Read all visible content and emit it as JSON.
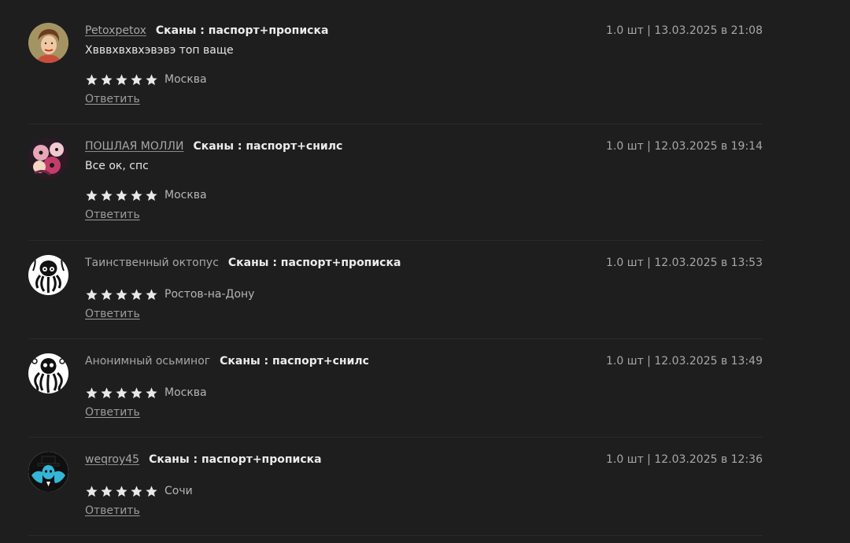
{
  "reviews": [
    {
      "author": "Petoxpetox",
      "product": "Сканы : паспорт+прописка",
      "meta": "1.0 шт | 13.03.2025 в 21:08",
      "text": "Хвввхвхвхэвэвэ топ ваще",
      "rating": 5,
      "city": "Москва",
      "reply": "Ответить",
      "avatar_icon": "pinup-woman-avatar-icon"
    },
    {
      "author": "ПОШЛАЯ МОЛЛИ",
      "product": "Сканы : паспорт+снилс",
      "meta": "1.0 шт | 12.03.2025 в 19:14",
      "text": "Все ок, спс",
      "rating": 5,
      "city": "Москва",
      "reply": "Ответить",
      "avatar_icon": "cartoon-collage-avatar-icon"
    },
    {
      "author": "Таинственный октопус",
      "product": "Сканы : паспорт+прописка",
      "meta": "1.0 шт | 12.03.2025 в 13:53",
      "text": "",
      "rating": 5,
      "city": "Ростов-на-Дону",
      "reply": "Ответить",
      "avatar_icon": "octopus-avatar-icon"
    },
    {
      "author": "Анонимный осьминог",
      "product": "Сканы : паспорт+снилс",
      "meta": "1.0 шт | 12.03.2025 в 13:49",
      "text": "",
      "rating": 5,
      "city": "Москва",
      "reply": "Ответить",
      "avatar_icon": "octopus-avatar-icon"
    },
    {
      "author": "weqroy45",
      "product": "Сканы : паспорт+прописка",
      "meta": "1.0 шт | 12.03.2025 в 12:36",
      "text": "",
      "rating": 5,
      "city": "Сочи",
      "reply": "Ответить",
      "avatar_icon": "top-hat-man-avatar-icon"
    }
  ],
  "colors": {
    "background": "#1e1e1e",
    "text": "#e6e6e6",
    "muted": "#a7a7a7",
    "star": "#e8e8e8",
    "divider": "#2a2a2a"
  }
}
